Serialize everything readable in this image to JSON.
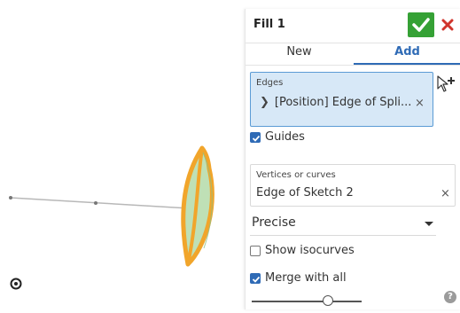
{
  "feature": {
    "title": "Fill 1"
  },
  "tabs": [
    {
      "label": "New",
      "active": false
    },
    {
      "label": "Add",
      "active": true
    }
  ],
  "edges": {
    "label": "Edges",
    "items": [
      {
        "text": "[Position] Edge of Spli...",
        "remove": "×"
      }
    ]
  },
  "guides": {
    "label": "Guides",
    "checked": true
  },
  "vertices_or_curves": {
    "label": "Vertices or curves",
    "value": "Edge of Sketch 2",
    "remove": "×"
  },
  "continuity": {
    "selected": "Precise"
  },
  "show_isocurves": {
    "label": "Show isocurves",
    "checked": false
  },
  "merge_with_all": {
    "label": "Merge with all",
    "checked": true
  },
  "slider": {
    "level": 0.71
  },
  "help": {
    "glyph": "?"
  },
  "colors": {
    "accent": "#2f6bb6",
    "ok": "#35a135",
    "cancel": "#d0342c",
    "selection_fill": "#d7e8f7",
    "model_edge": "#f1a52b",
    "model_surface": "#bfe0b6"
  },
  "icons": {
    "ok": "checkmark-icon",
    "cancel": "close-icon",
    "add_selection_cursor": "cursor-plus-icon",
    "expand": "chevron-right-icon",
    "help": "help-icon",
    "view_target": "target-icon"
  }
}
